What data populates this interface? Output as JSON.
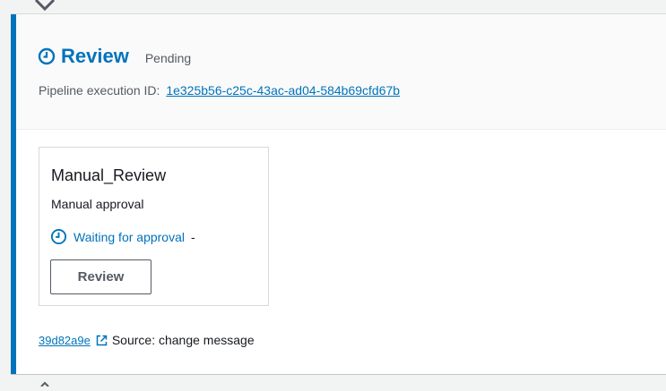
{
  "stage": {
    "title": "Review",
    "status": "Pending",
    "execution_label": "Pipeline execution ID:",
    "execution_id": "1e325b56-c25c-43ac-ad04-584b69cfd67b",
    "icon": "clock-icon"
  },
  "action": {
    "name": "Manual_Review",
    "type": "Manual approval",
    "status": "Waiting for approval",
    "status_suffix": "-",
    "button_label": "Review",
    "icon": "clock-icon"
  },
  "commit": {
    "id": "39d82a9e",
    "source": "Source: change message",
    "icon": "external-link-icon"
  },
  "colors": {
    "accent": "#0073bb",
    "text_secondary": "#545b64"
  }
}
